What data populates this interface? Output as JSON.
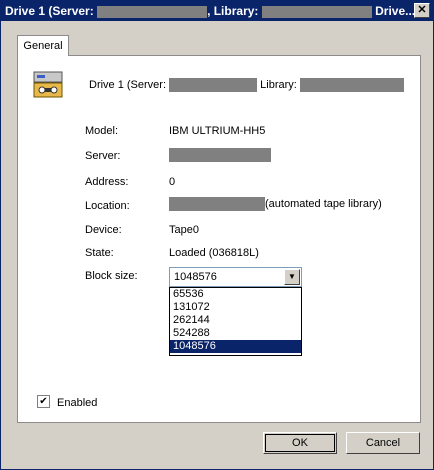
{
  "window": {
    "title_prefix": "Drive 1 (Server:",
    "title_library": ", Library:",
    "title_suffix": "Drive...",
    "close_glyph": "✕"
  },
  "tabs": [
    {
      "label": "General"
    }
  ],
  "header": {
    "drive_label": "Drive 1 (Server:",
    "library_label": "Library:"
  },
  "details": {
    "model_label": "Model:",
    "model_value": "IBM ULTRIUM-HH5",
    "server_label": "Server:",
    "address_label": "Address:",
    "address_value": "0",
    "location_label": "Location:",
    "location_suffix": "(automated tape library)",
    "device_label": "Device:",
    "device_value": "Tape0",
    "state_label": "State:",
    "state_value": "Loaded (036818L)",
    "block_size_label": "Block size:"
  },
  "block_size": {
    "selected": "1048576",
    "options": [
      "65536",
      "131072",
      "262144",
      "524288",
      "1048576"
    ],
    "arrow_glyph": "▼"
  },
  "enabled": {
    "label": "Enabled",
    "checked": true,
    "glyph": "✔"
  },
  "buttons": {
    "ok": "OK",
    "cancel": "Cancel"
  },
  "icons": {
    "drive": "tape-drive-icon",
    "close": "close-icon",
    "dropdown": "chevron-down-icon"
  },
  "colors": {
    "titlebar": "#0a246a",
    "selection": "#0a246a",
    "redaction": "#808080"
  }
}
